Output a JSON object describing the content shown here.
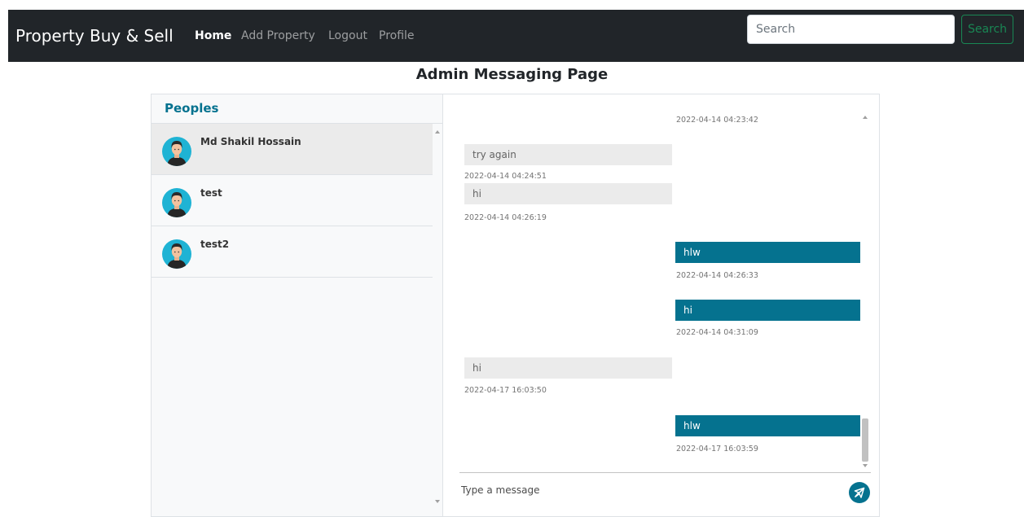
{
  "navbar": {
    "brand": "Property Buy & Sell",
    "links": [
      {
        "label": "Home",
        "active": true
      },
      {
        "label": "Add Property",
        "active": false
      },
      {
        "label": "Logout",
        "active": false
      },
      {
        "label": "Profile",
        "active": false
      }
    ],
    "search": {
      "placeholder": "Search",
      "button_label": "Search"
    }
  },
  "page_title": "Admin Messaging Page",
  "people": {
    "title": "Peoples",
    "items": [
      {
        "name": "Md Shakil Hossain",
        "active": true
      },
      {
        "name": "test",
        "active": false
      },
      {
        "name": "test2",
        "active": false
      }
    ]
  },
  "chat": {
    "messages": [
      {
        "direction": "outgoing",
        "text": "",
        "time": "2022-04-14 04:23:42"
      },
      {
        "direction": "incoming",
        "text": "try again",
        "time": "2022-04-14 04:24:51"
      },
      {
        "direction": "incoming",
        "text": "hi",
        "time": "2022-04-14 04:26:19"
      },
      {
        "direction": "outgoing",
        "text": "hlw",
        "time": "2022-04-14 04:26:33"
      },
      {
        "direction": "outgoing",
        "text": "hi",
        "time": "2022-04-14 04:31:09"
      },
      {
        "direction": "incoming",
        "text": "hi",
        "time": "2022-04-17 16:03:50"
      },
      {
        "direction": "outgoing",
        "text": "hlw",
        "time": "2022-04-17 16:03:59"
      }
    ],
    "compose": {
      "placeholder": "Type a message"
    }
  },
  "colors": {
    "navbar_bg": "#212529",
    "accent": "#05728f",
    "incoming_bubble": "#ebebeb",
    "search_button": "#198754",
    "avatar_bg": "#1fb3d4"
  },
  "icons": {
    "send": "paper-plane-icon",
    "avatar": "user-avatar-icon"
  }
}
